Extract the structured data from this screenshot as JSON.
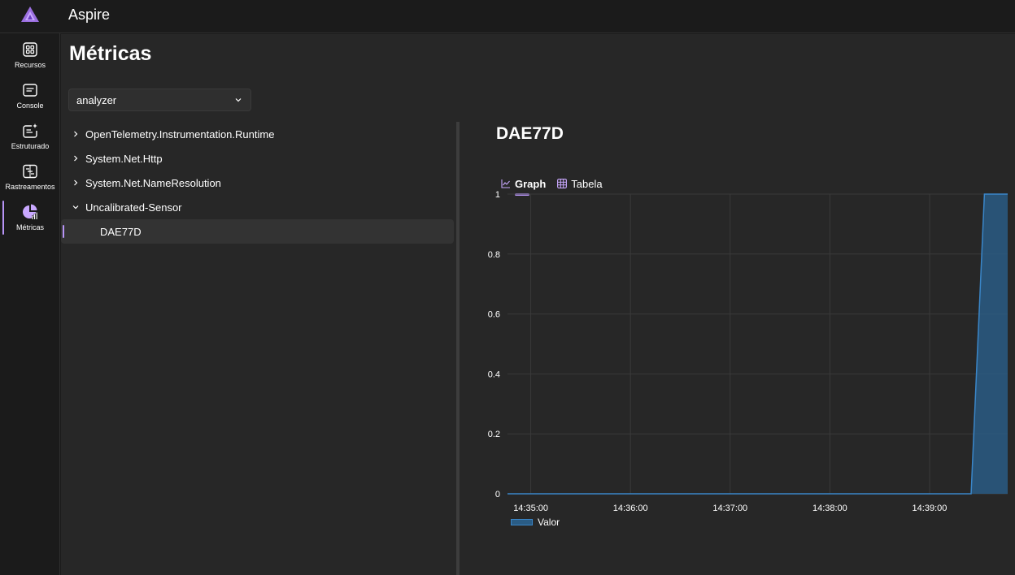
{
  "app": {
    "title": "Aspire"
  },
  "nav": {
    "items": [
      {
        "label": "Recursos",
        "icon": "grid-icon"
      },
      {
        "label": "Console",
        "icon": "console-icon"
      },
      {
        "label": "Estruturado",
        "icon": "structured-logs-icon"
      },
      {
        "label": "Rastreamentos",
        "icon": "traces-icon"
      },
      {
        "label": "Métricas",
        "icon": "metrics-icon",
        "active": true
      }
    ]
  },
  "page": {
    "title": "Métricas",
    "resource_select": {
      "value": "analyzer"
    }
  },
  "tree": {
    "items": [
      {
        "label": "OpenTelemetry.Instrumentation.Runtime",
        "expanded": false
      },
      {
        "label": "System.Net.Http",
        "expanded": false
      },
      {
        "label": "System.Net.NameResolution",
        "expanded": false
      },
      {
        "label": "Uncalibrated-Sensor",
        "expanded": true
      }
    ],
    "selected_leaf": "DAE77D"
  },
  "detail": {
    "title": "DAE77D",
    "tabs": [
      {
        "label": "Graph",
        "active": true
      },
      {
        "label": "Tabela",
        "active": false
      }
    ]
  },
  "colors": {
    "accent": "#b794f6",
    "series_line": "#3a86c8",
    "series_fill": "#2a5c85"
  },
  "chart_data": {
    "type": "area",
    "title": "",
    "xlabel": "",
    "ylabel": "",
    "ylim": [
      0,
      1
    ],
    "yticks": [
      "0",
      "0.2",
      "0.4",
      "0.6",
      "0.8",
      "1"
    ],
    "xticks": [
      "14:35:00",
      "14:36:00",
      "14:37:00",
      "14:38:00",
      "14:39:00"
    ],
    "xlim": [
      "14:34:46",
      "14:39:47"
    ],
    "grid": true,
    "legend": "bottom-left",
    "series": [
      {
        "name": "Valor",
        "x": [
          "14:34:46",
          "14:39:25",
          "14:39:33",
          "14:39:47"
        ],
        "values": [
          0,
          0,
          1,
          1
        ]
      }
    ]
  }
}
